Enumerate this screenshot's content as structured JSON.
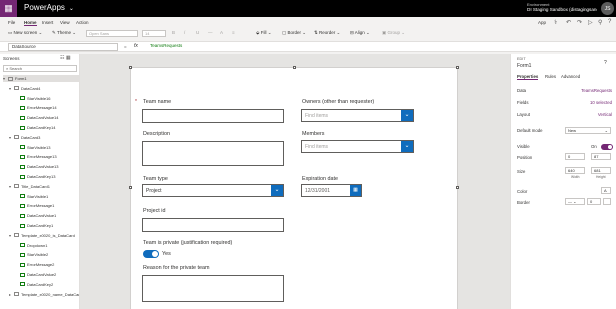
{
  "app": {
    "name": "PowerApps",
    "env_label": "Environment",
    "env_name": "DI Staging Sandbox (distagingsandbox)",
    "avatar": "JS"
  },
  "menu": {
    "items": [
      "File",
      "Home",
      "Insert",
      "View",
      "Action"
    ],
    "active": "Home",
    "right": [
      "App"
    ]
  },
  "toolbar": {
    "new_screen": "New screen",
    "theme": "Theme",
    "font": "Open Sans",
    "size": "14",
    "fill": "Fill",
    "border": "Border",
    "reorder": "Reorder",
    "align": "Align",
    "group": "Group"
  },
  "formula": {
    "property": "DataSource",
    "eq": "=",
    "fx": "fx",
    "value": "TeamsRequests"
  },
  "tree": {
    "title": "Screens",
    "search_placeholder": "Search",
    "items": [
      {
        "label": "Form1",
        "indent": 0,
        "sel": true,
        "expand": "▾"
      },
      {
        "label": "DataCard4",
        "indent": 1,
        "expand": "▾"
      },
      {
        "label": "StarVisible16",
        "indent": 2
      },
      {
        "label": "ErrorMessage14",
        "indent": 2
      },
      {
        "label": "DataCardValue14",
        "indent": 2
      },
      {
        "label": "DataCardKey14",
        "indent": 2
      },
      {
        "label": "DataCard3",
        "indent": 1,
        "expand": "▾"
      },
      {
        "label": "StarVisible13",
        "indent": 2
      },
      {
        "label": "ErrorMessage13",
        "indent": 2
      },
      {
        "label": "DataCardValue13",
        "indent": 2
      },
      {
        "label": "DataCardKey13",
        "indent": 2
      },
      {
        "label": "Title_DataCard1",
        "indent": 1,
        "expand": "▾"
      },
      {
        "label": "StarVisible1",
        "indent": 2
      },
      {
        "label": "ErrorMessage1",
        "indent": 2
      },
      {
        "label": "DataCardValue1",
        "indent": 2
      },
      {
        "label": "DataCardKey1",
        "indent": 2
      },
      {
        "label": "Template_x0020_is_DataCard",
        "indent": 1,
        "expand": "▾"
      },
      {
        "label": "Dropdown1",
        "indent": 2
      },
      {
        "label": "StarVisible2",
        "indent": 2
      },
      {
        "label": "ErrorMessage2",
        "indent": 2
      },
      {
        "label": "DataCardValue2",
        "indent": 2
      },
      {
        "label": "DataCardKey2",
        "indent": 2
      },
      {
        "label": "Template_x0020_name_DataCard",
        "indent": 1,
        "expand": "▸"
      }
    ]
  },
  "form": {
    "team_name": "Team name",
    "description": "Description",
    "team_type": "Team type",
    "team_type_value": "Project",
    "project_id": "Project id",
    "private_label": "Team is private (justification required)",
    "private_toggle": "Yes",
    "reason": "Reason for the private team",
    "owners": "Owners (other than requester)",
    "owners_placeholder": "Find items",
    "members": "Members",
    "members_placeholder": "Find items",
    "expiration": "Expiration date",
    "expiration_value": "12/31/2001",
    "required_star": "*"
  },
  "props": {
    "type": "EDIT",
    "name": "Form1",
    "tabs": [
      "Properties",
      "Rules",
      "Advanced"
    ],
    "active_tab": "Properties",
    "data_label": "Data",
    "data_value": "TeamsRequests",
    "fields_label": "Fields",
    "fields_value": "10 selected",
    "layout_label": "Layout",
    "layout_value": "Vertical",
    "default_mode_label": "Default mode",
    "default_mode_value": "New",
    "visible_label": "Visible",
    "visible_value": "On",
    "position_label": "Position",
    "pos_x": "0",
    "pos_y": "87",
    "size_label": "Size",
    "size_w": "640",
    "size_h": "681",
    "width_caption": "Width",
    "height_caption": "Height",
    "color_label": "Color",
    "border_label": "Border",
    "border_value": "0",
    "help_icon": "?"
  },
  "colors": {
    "brand": "#742774",
    "accent": "#0f6cbd"
  }
}
